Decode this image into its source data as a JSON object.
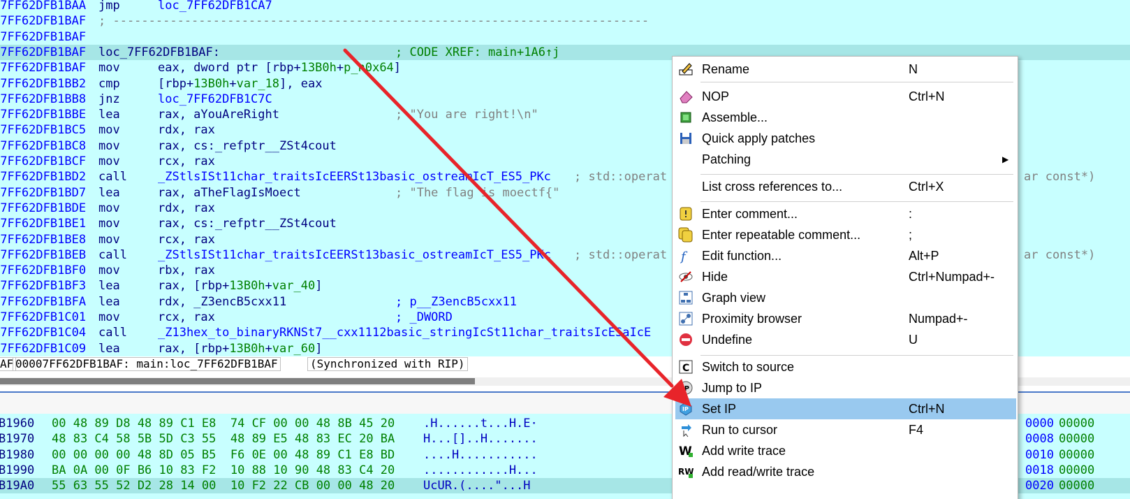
{
  "disasm": {
    "lines": [
      {
        "addr": "07FF62DFB1BAA",
        "mnem": "jmp",
        "ops": "loc_7FF62DFB1CA7"
      },
      {
        "addr": "07FF62DFB1BAF",
        "sep": "; ---------------------------------------------------------------------------"
      },
      {
        "addr": "07FF62DFB1BAF"
      },
      {
        "addr": "07FF62DFB1BAF",
        "label": "loc_7FF62DFB1BAF:",
        "xref": "; CODE XREF: main+1A6↑j"
      },
      {
        "addr": "07FF62DFB1BAF",
        "mnem": "mov",
        "ops_parts": [
          "eax, dword ptr [rbp+",
          "13B0h",
          "+",
          "p_n0x64",
          "]"
        ]
      },
      {
        "addr": "07FF62DFB1BB2",
        "mnem": "cmp",
        "ops_parts": [
          "[rbp+",
          "13B0h",
          "+",
          "var_18",
          "], eax"
        ]
      },
      {
        "addr": "07FF62DFB1BB8",
        "mnem": "jnz",
        "ops": "loc_7FF62DFB1C7C"
      },
      {
        "addr": "07FF62DFB1BBE",
        "mnem": "lea",
        "ops": "rax, aYouAreRight",
        "cmt": "; \"You are right!\\n\""
      },
      {
        "addr": "07FF62DFB1BC5",
        "mnem": "mov",
        "ops": "rdx, rax"
      },
      {
        "addr": "07FF62DFB1BC8",
        "mnem": "mov",
        "ops": "rax, cs:_refptr__ZSt4cout"
      },
      {
        "addr": "07FF62DFB1BCF",
        "mnem": "mov",
        "ops": "rcx, rax"
      },
      {
        "addr": "07FF62DFB1BD2",
        "mnem": "call",
        "ops": "_ZStlsISt11char_traitsIcEERSt13basic_ostreamIcT_ES5_PKc",
        "cmt2": "; std::operat",
        "tail": "ar const*)"
      },
      {
        "addr": "07FF62DFB1BD7",
        "mnem": "lea",
        "ops": "rax, aTheFlagIsMoect",
        "cmt": "; \"The flag is moectf{\""
      },
      {
        "addr": "07FF62DFB1BDE",
        "mnem": "mov",
        "ops": "rdx, rax"
      },
      {
        "addr": "07FF62DFB1BE1",
        "mnem": "mov",
        "ops": "rax, cs:_refptr__ZSt4cout"
      },
      {
        "addr": "07FF62DFB1BE8",
        "mnem": "mov",
        "ops": "rcx, rax"
      },
      {
        "addr": "07FF62DFB1BEB",
        "mnem": "call",
        "ops": "_ZStlsISt11char_traitsIcEERSt13basic_ostreamIcT_ES5_PKc",
        "cmt2": "; std::operat",
        "tail": "ar const*)"
      },
      {
        "addr": "07FF62DFB1BF0",
        "mnem": "mov",
        "ops": "rbx, rax"
      },
      {
        "addr": "07FF62DFB1BF3",
        "mnem": "lea",
        "ops_parts": [
          "rax, [rbp+",
          "13B0h",
          "+",
          "var_40",
          "]"
        ]
      },
      {
        "addr": "07FF62DFB1BFA",
        "mnem": "lea",
        "ops": "rdx, _Z3encB5cxx11",
        "cmt": "; p__Z3encB5cxx11"
      },
      {
        "addr": "07FF62DFB1C01",
        "mnem": "mov",
        "ops": "rcx, rax",
        "cmt": "; _DWORD"
      },
      {
        "addr": "07FF62DFB1C04",
        "mnem": "call",
        "ops": "_Z13hex_to_binaryRKNSt7__cxx1112basic_stringIcSt11char_traitsIcESaIcE"
      },
      {
        "addr": "07FF62DFB1C09",
        "mnem": "lea",
        "ops_parts": [
          "rax, [rbp+",
          "13B0h",
          "+",
          "var_60",
          "]"
        ]
      }
    ]
  },
  "status": {
    "left": "AF",
    "location": "00007FF62DFB1BAF: main:loc_7FF62DFB1BAF",
    "sync": "(Synchronized with RIP)"
  },
  "hex": {
    "rows": [
      {
        "addr": "B1960",
        "bytes": "00 48 89 D8 48 89 C1 E8  74 CF 00 00 48 8B 45 20",
        "ascii": ".H......t...H.E·",
        "r1": "0000",
        "r2": "00000"
      },
      {
        "addr": "B1970",
        "bytes": "48 83 C4 58 5B 5D C3 55  48 89 E5 48 83 EC 20 BA",
        "ascii": "H...[]..H.......",
        "r1": "0008",
        "r2": "00000"
      },
      {
        "addr": "B1980",
        "bytes": "00 00 00 00 48 8D 05 B5  F6 0E 00 48 89 C1 E8 BD",
        "ascii": "....H...........",
        "r1": "0010",
        "r2": "00000"
      },
      {
        "addr": "B1990",
        "bytes": "BA 0A 00 0F B6 10 83 F2  10 88 10 90 48 83 C4 20",
        "ascii": "............H...",
        "r1": "0018",
        "r2": "00000"
      },
      {
        "addr": "B19A0",
        "bytes": "55 63 55 52 D2 28 14 00  10 F2 22 CB 00 00 48 20",
        "ascii": "UcUR.(....\"...H ",
        "r1": "0020",
        "r2": "00000"
      }
    ]
  },
  "menu": {
    "items": [
      {
        "label": "Rename",
        "shortcut": "N",
        "icon": "rename-icon"
      },
      {
        "label": "NOP",
        "shortcut": "Ctrl+N",
        "icon": "nop-eraser-icon"
      },
      {
        "label": "Assemble...",
        "shortcut": "",
        "icon": "chip-icon"
      },
      {
        "label": "Quick apply patches",
        "shortcut": "",
        "icon": "floppy-icon"
      },
      {
        "label": "Patching",
        "shortcut": "",
        "icon": "",
        "submenu": true
      },
      {
        "label": "List cross references to...",
        "shortcut": "Ctrl+X",
        "icon": ""
      },
      {
        "label": "Enter comment...",
        "shortcut": ":",
        "icon": "comment-icon"
      },
      {
        "label": "Enter repeatable comment...",
        "shortcut": ";",
        "icon": "repeat-comment-icon"
      },
      {
        "label": "Edit function...",
        "shortcut": "Alt+P",
        "icon": "function-icon"
      },
      {
        "label": "Hide",
        "shortcut": "Ctrl+Numpad+-",
        "icon": "eye-icon"
      },
      {
        "label": "Graph view",
        "shortcut": "",
        "icon": "graph-icon"
      },
      {
        "label": "Proximity browser",
        "shortcut": "Numpad+-",
        "icon": "proximity-icon"
      },
      {
        "label": "Undefine",
        "shortcut": "U",
        "icon": "undefine-icon"
      },
      {
        "label": "Switch to source",
        "shortcut": "",
        "icon": "source-icon"
      },
      {
        "label": "Jump to IP",
        "shortcut": "",
        "icon": "jump-ip-icon"
      },
      {
        "label": "Set IP",
        "shortcut": "Ctrl+N",
        "icon": "set-ip-icon",
        "selected": true
      },
      {
        "label": "Run to cursor",
        "shortcut": "F4",
        "icon": "run-cursor-icon"
      },
      {
        "label": "Add write trace",
        "shortcut": "",
        "icon": "write-trace-icon"
      },
      {
        "label": "Add read/write trace",
        "shortcut": "",
        "icon": "rw-trace-icon"
      }
    ]
  },
  "colors": {
    "listing_bg": "#c8ffff",
    "highlight_line": "#a6e6e6",
    "menu_selected": "#99c9ef",
    "annotation_arrow": "#e8242a"
  }
}
